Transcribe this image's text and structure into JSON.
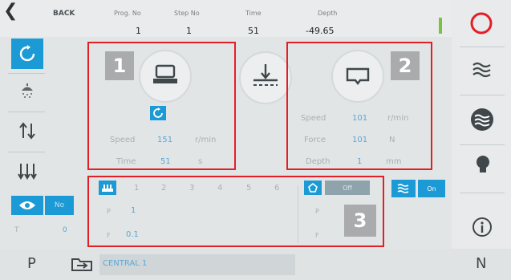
{
  "header": {
    "back_label": "BACK",
    "columns": [
      {
        "label": "Prog. No",
        "value": "1"
      },
      {
        "label": "Step No",
        "value": "1"
      },
      {
        "label": "Time",
        "value": "51"
      },
      {
        "label": "Depth",
        "value": "-49.65"
      }
    ]
  },
  "box1": {
    "badge": "1",
    "speed_label": "Speed",
    "speed_value": "151",
    "speed_unit": "r/min",
    "time_label": "Time",
    "time_value": "51",
    "time_unit": "s"
  },
  "box2": {
    "badge": "2",
    "speed_label": "Speed",
    "speed_value": "101",
    "speed_unit": "r/min",
    "force_label": "Force",
    "force_value": "101",
    "force_unit": "N",
    "depth_label": "Depth",
    "depth_value": "1",
    "depth_unit": "mm"
  },
  "box3": {
    "badge": "3",
    "steps": [
      "1",
      "2",
      "3",
      "4",
      "5",
      "6"
    ],
    "p_label": "P",
    "p_value": "1",
    "f_label": "F",
    "f_value": "0.1",
    "p2_label": "P",
    "f2_label": "F",
    "off_label": "Off",
    "on_label": "On"
  },
  "left": {
    "no_label": "No",
    "t_label": "T",
    "t_value": "0"
  },
  "bottom": {
    "p_label": "P",
    "path": "CENTRAL 1",
    "n_label": "N"
  },
  "colors": {
    "accent_blue": "#1c9ad6",
    "highlight_red": "#e41e26",
    "status_green": "#7cc142"
  }
}
